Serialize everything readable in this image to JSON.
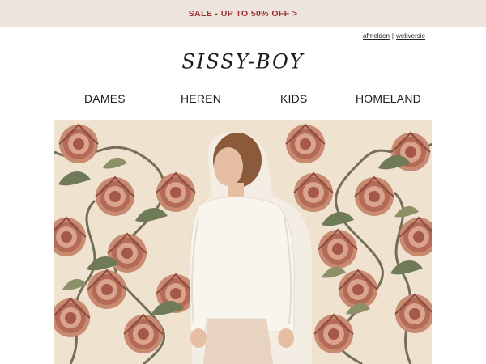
{
  "promo": {
    "text": "SALE - UP TO 50% OFF >"
  },
  "utility": {
    "unsubscribe": "afmelden",
    "separator": "|",
    "webversion": "webversie"
  },
  "brand": {
    "logo_text": "SISSY-BOY"
  },
  "nav": {
    "items": [
      "DAMES",
      "HEREN",
      "KIDS",
      "HOMELAND"
    ]
  },
  "colors": {
    "banner_bg": "#ede4dd",
    "promo_text": "#9a2f33",
    "pattern_bg": "#efe3cf"
  },
  "hero": {
    "icon": "model-in-cream-knit-sweater-photo"
  }
}
